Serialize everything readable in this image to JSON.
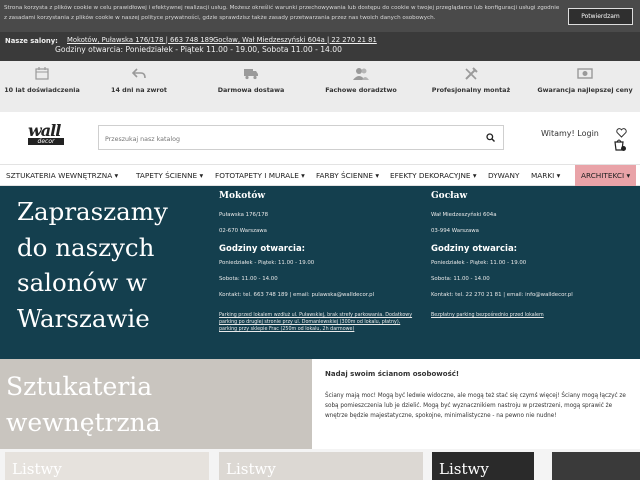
{
  "cookie": {
    "text": "Strona korzysta z plików cookie w celu prawidłowej i efektywnej realizacji usług. Możesz określić warunki przechowywania lub dostępu do cookie w twojej przeglądarce lub konfiguracji usługi zgodnie z zasadami korzystania z plików cookie w naszej polityce prywatności, gdzie sprawdzisz także zasady przetwarzania przez nas twoich danych osobowych.",
    "button": "Potwierdzam"
  },
  "salons_bar": {
    "label": "Nasze salony:",
    "addr1": "Mokotów, Puławska 176/178 | 663 748 189",
    "addr2": "Gocław, Wał Miedzeszyński 604a | 22 270 21 81",
    "hours": "Godziny otwarcia: Poniedziałek - Piątek 11.00 - 19.00, Sobota 11.00 - 14.00"
  },
  "usp": [
    {
      "label": "10 lat doświadczenia",
      "icon": "calendar-icon"
    },
    {
      "label": "14 dni na zwrot",
      "icon": "return-arrow-icon"
    },
    {
      "label": "Darmowa dostawa",
      "icon": "truck-icon"
    },
    {
      "label": "Fachowe doradztwo",
      "icon": "people-icon"
    },
    {
      "label": "Profesjonalny montaż",
      "icon": "tools-icon"
    },
    {
      "label": "Gwarancja najlepszej ceny",
      "icon": "money-icon"
    }
  ],
  "header": {
    "logo_top": "wall",
    "logo_bottom": "decor",
    "search_placeholder": "Przeszukaj nasz katalog",
    "welcome": "Witamy! Login"
  },
  "nav": [
    "SZTUKATERIA WEWNĘTRZNA",
    "TAPETY ŚCIENNE",
    "FOTOTAPETY I MURALE",
    "FARBY ŚCIENNE",
    "EFEKTY DEKORACYJNE",
    "DYWANY",
    "MARKI",
    "ARCHITEKCI"
  ],
  "hero": {
    "title": "Zapraszamy do naszych salonów w Warszawie",
    "mokotow": {
      "name": "Mokotów",
      "street": "Puławska 176/178",
      "city": "02-670 Warszawa",
      "hours_title": "Godziny otwarcia:",
      "weekday": "Poniedziałek - Piątek: 11.00 - 19.00",
      "saturday": "Sobota: 11.00 - 14.00",
      "contact": "Kontakt: tel. 663 748 189 | email: pulawska@walldecor.pl",
      "parking": "Parking przed lokalem wzdłuż ul. Puławskiej, brak strefy parkowania. Dodatkowy parking po drugiej stronie przy ul. Domaniewskiej (300m od lokalu, płatny), parking przy sklepie Frac (250m od lokalu, 2h darmowe)"
    },
    "goclaw": {
      "name": "Gocław",
      "street": "Wał Miedzeszyński 604a",
      "city": "03-994 Warszawa",
      "hours_title": "Godziny otwarcia:",
      "weekday": "Poniedziałek - Piątek: 11.00 - 19.00",
      "saturday": "Sobota: 11.00 - 14.00",
      "contact": "Kontakt: tel. 22 270 21 81 | email: info@walldecor.pl",
      "parking": "Bezpłatny parking bezpośrednio przed lokalem"
    }
  },
  "section": {
    "title": "Sztukateria wewnętrzna",
    "heading": "Nadaj swoim ścianom osobowość!",
    "body": "Ściany mają moc! Mogą być ledwie widoczne, ale mogą też stać się czymś więcej! Ściany mogą łączyć ze sobą pomieszczenia lub je dzielić. Mogą być wyznacznikiem nastroju w przestrzeni, mogą sprawić że wnętrze będzie majestatyczne, spokojne, minimalistyczne - na pewno nie nudne!"
  },
  "cards": [
    "Listwy",
    "Listwy",
    "Listwy"
  ],
  "colors": {
    "hero_bg": "#143f4e",
    "architects_bg": "#e9a3a8",
    "section_left_bg": "#c9c5bf"
  }
}
